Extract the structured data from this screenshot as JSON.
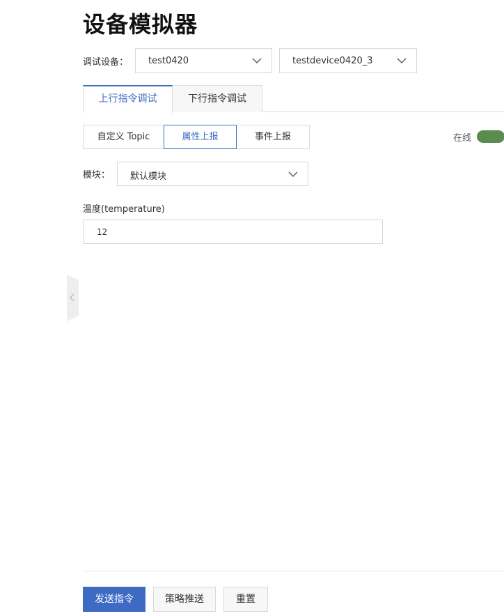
{
  "page": {
    "title": "设备模拟器"
  },
  "device": {
    "label": "调试设备：",
    "product_value": "test0420",
    "device_value": "testdevice0420_3"
  },
  "tabs": [
    {
      "label": "上行指令调试",
      "active": true
    },
    {
      "label": "下行指令调试",
      "active": false
    }
  ],
  "report_types": [
    {
      "label": "自定义 Topic",
      "active": false
    },
    {
      "label": "属性上报",
      "active": true
    },
    {
      "label": "事件上报",
      "active": false
    }
  ],
  "status": {
    "label": "在线",
    "on": true,
    "color": "#5b8c4f"
  },
  "module": {
    "label": "模块：",
    "value": "默认模块"
  },
  "property": {
    "label": "温度(temperature)",
    "value": "12"
  },
  "actions": {
    "send": "发送指令",
    "push": "策略推送",
    "reset": "重置"
  },
  "colors": {
    "accent": "#3d6bc4",
    "border": "#d9d9d9"
  }
}
